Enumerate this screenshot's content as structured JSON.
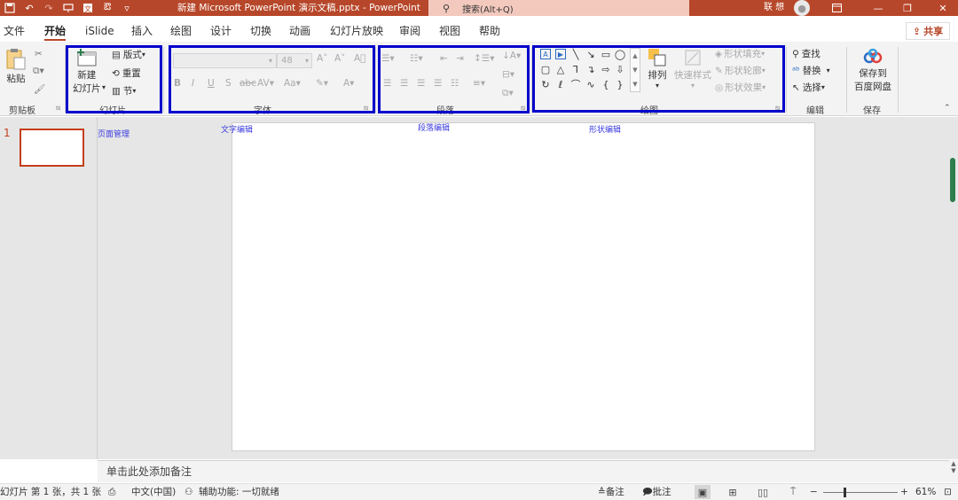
{
  "app": {
    "doc_title": "新建 Microsoft PowerPoint 演示文稿.pptx  -  PowerPoint",
    "search_label": "搜索(Alt+Q)",
    "user_name": "联 想",
    "share_label": "共享"
  },
  "tabs": [
    "文件",
    "开始",
    "iSlide",
    "插入",
    "绘图",
    "设计",
    "切换",
    "动画",
    "幻灯片放映",
    "审阅",
    "视图",
    "帮助"
  ],
  "active_tab": "开始",
  "ribbon": {
    "clipboard": {
      "paste": "粘贴",
      "group": "剪贴板"
    },
    "slides": {
      "new_slide_line1": "新建",
      "new_slide_line2": "幻灯片",
      "layout": "版式",
      "reset": "重置",
      "section": "节",
      "group": "幻灯片"
    },
    "font": {
      "size": "48",
      "group": "字体"
    },
    "paragraph": {
      "group": "段落"
    },
    "drawing": {
      "arrange": "排列",
      "quick_styles": "快速样式",
      "shape_fill": "形状填充",
      "shape_outline": "形状轮廓",
      "shape_effects": "形状效果",
      "group": "绘图"
    },
    "editing": {
      "find": "查找",
      "replace": "替换",
      "select": "选择",
      "group": "编辑"
    },
    "save": {
      "line1": "保存到",
      "line2": "百度网盘",
      "group": "保存"
    }
  },
  "annotations": {
    "page_mgmt": "页面管理",
    "text_edit": "文字编辑",
    "para_edit": "段落编辑",
    "shape_edit": "形状编辑"
  },
  "thumbnails": {
    "number": "1"
  },
  "notes": {
    "placeholder": "单击此处添加备注"
  },
  "status": {
    "slide_info": "幻灯片 第 1 张，共 1 张",
    "language": "中文(中国)",
    "accessibility": "辅助功能: 一切就绪",
    "notes_btn": "备注",
    "comments_btn": "批注",
    "zoom": "61%"
  },
  "colors": {
    "brand": "#b7472a",
    "highlight_box": "#0000cc",
    "annotation": "#3a3ae0"
  }
}
